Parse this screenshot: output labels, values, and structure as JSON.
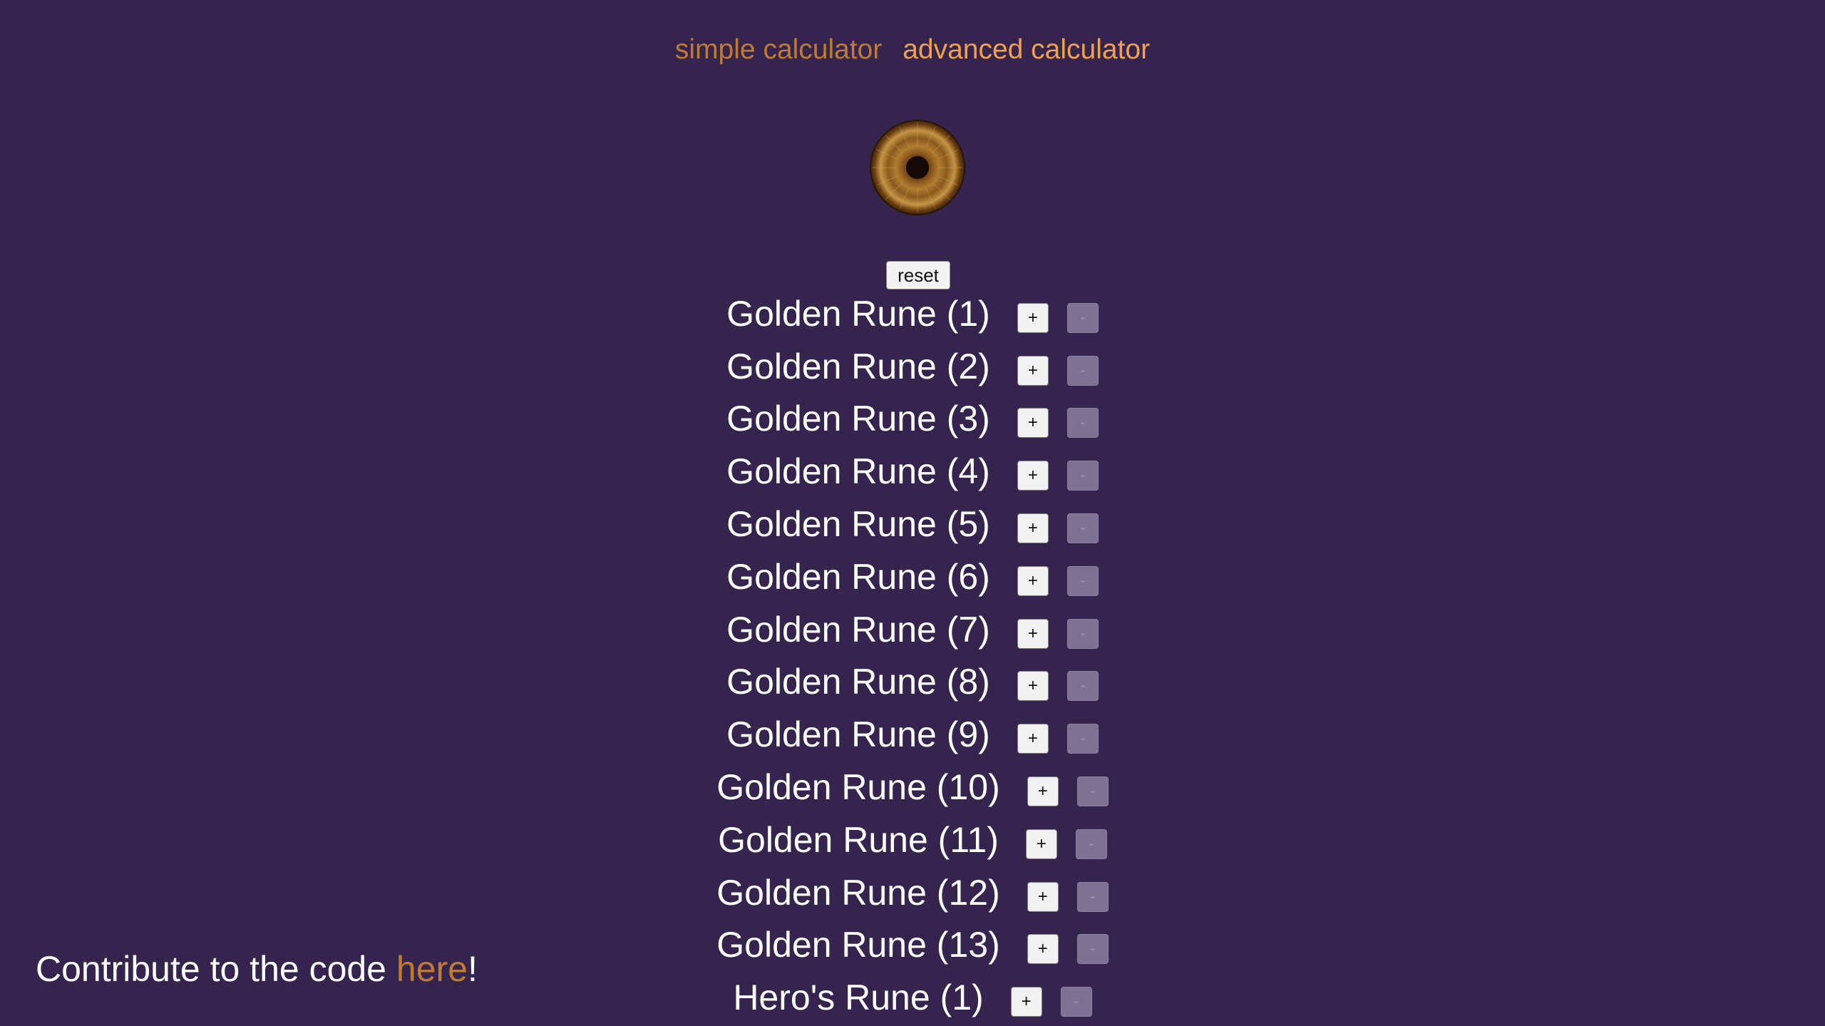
{
  "nav": {
    "simple_label": "simple calculator",
    "advanced_label": "advanced calculator"
  },
  "icon": "golden-rune-icon",
  "colors": {
    "background": "#35244d",
    "link": "#c07a34",
    "link_active": "#f0a050",
    "text": "#ffffff"
  },
  "reset_label": "reset",
  "plus_label": "+",
  "minus_label": "-",
  "runes": [
    "Golden Rune (1)",
    "Golden Rune (2)",
    "Golden Rune (3)",
    "Golden Rune (4)",
    "Golden Rune (5)",
    "Golden Rune (6)",
    "Golden Rune (7)",
    "Golden Rune (8)",
    "Golden Rune (9)",
    "Golden Rune (10)",
    "Golden Rune (11)",
    "Golden Rune (12)",
    "Golden Rune (13)",
    "Hero's Rune (1)"
  ],
  "footer": {
    "prefix": "Contribute to the code ",
    "link_label": "here",
    "suffix": "!"
  }
}
